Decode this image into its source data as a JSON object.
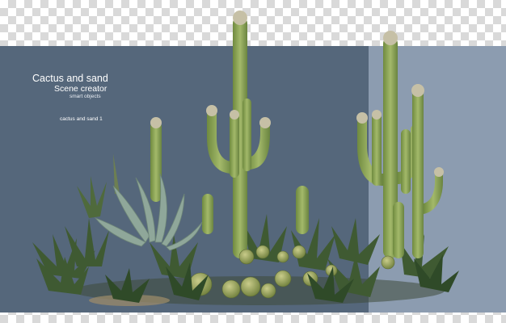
{
  "header": {
    "title": "Cactus and sand",
    "subtitle": "Scene creator",
    "tagline": "smart objects"
  },
  "item_label": "cactus and sand 1",
  "colors": {
    "panel_dark": "#55677b",
    "panel_light": "#8c9cb0",
    "cactus_green": "#8ea55a",
    "shrub_green": "#3f5a32",
    "agave_blue": "#8fa79a"
  },
  "icons": [
    "saguaro-cactus",
    "barrel-cactus",
    "agave-plant",
    "yucca-shrub"
  ]
}
